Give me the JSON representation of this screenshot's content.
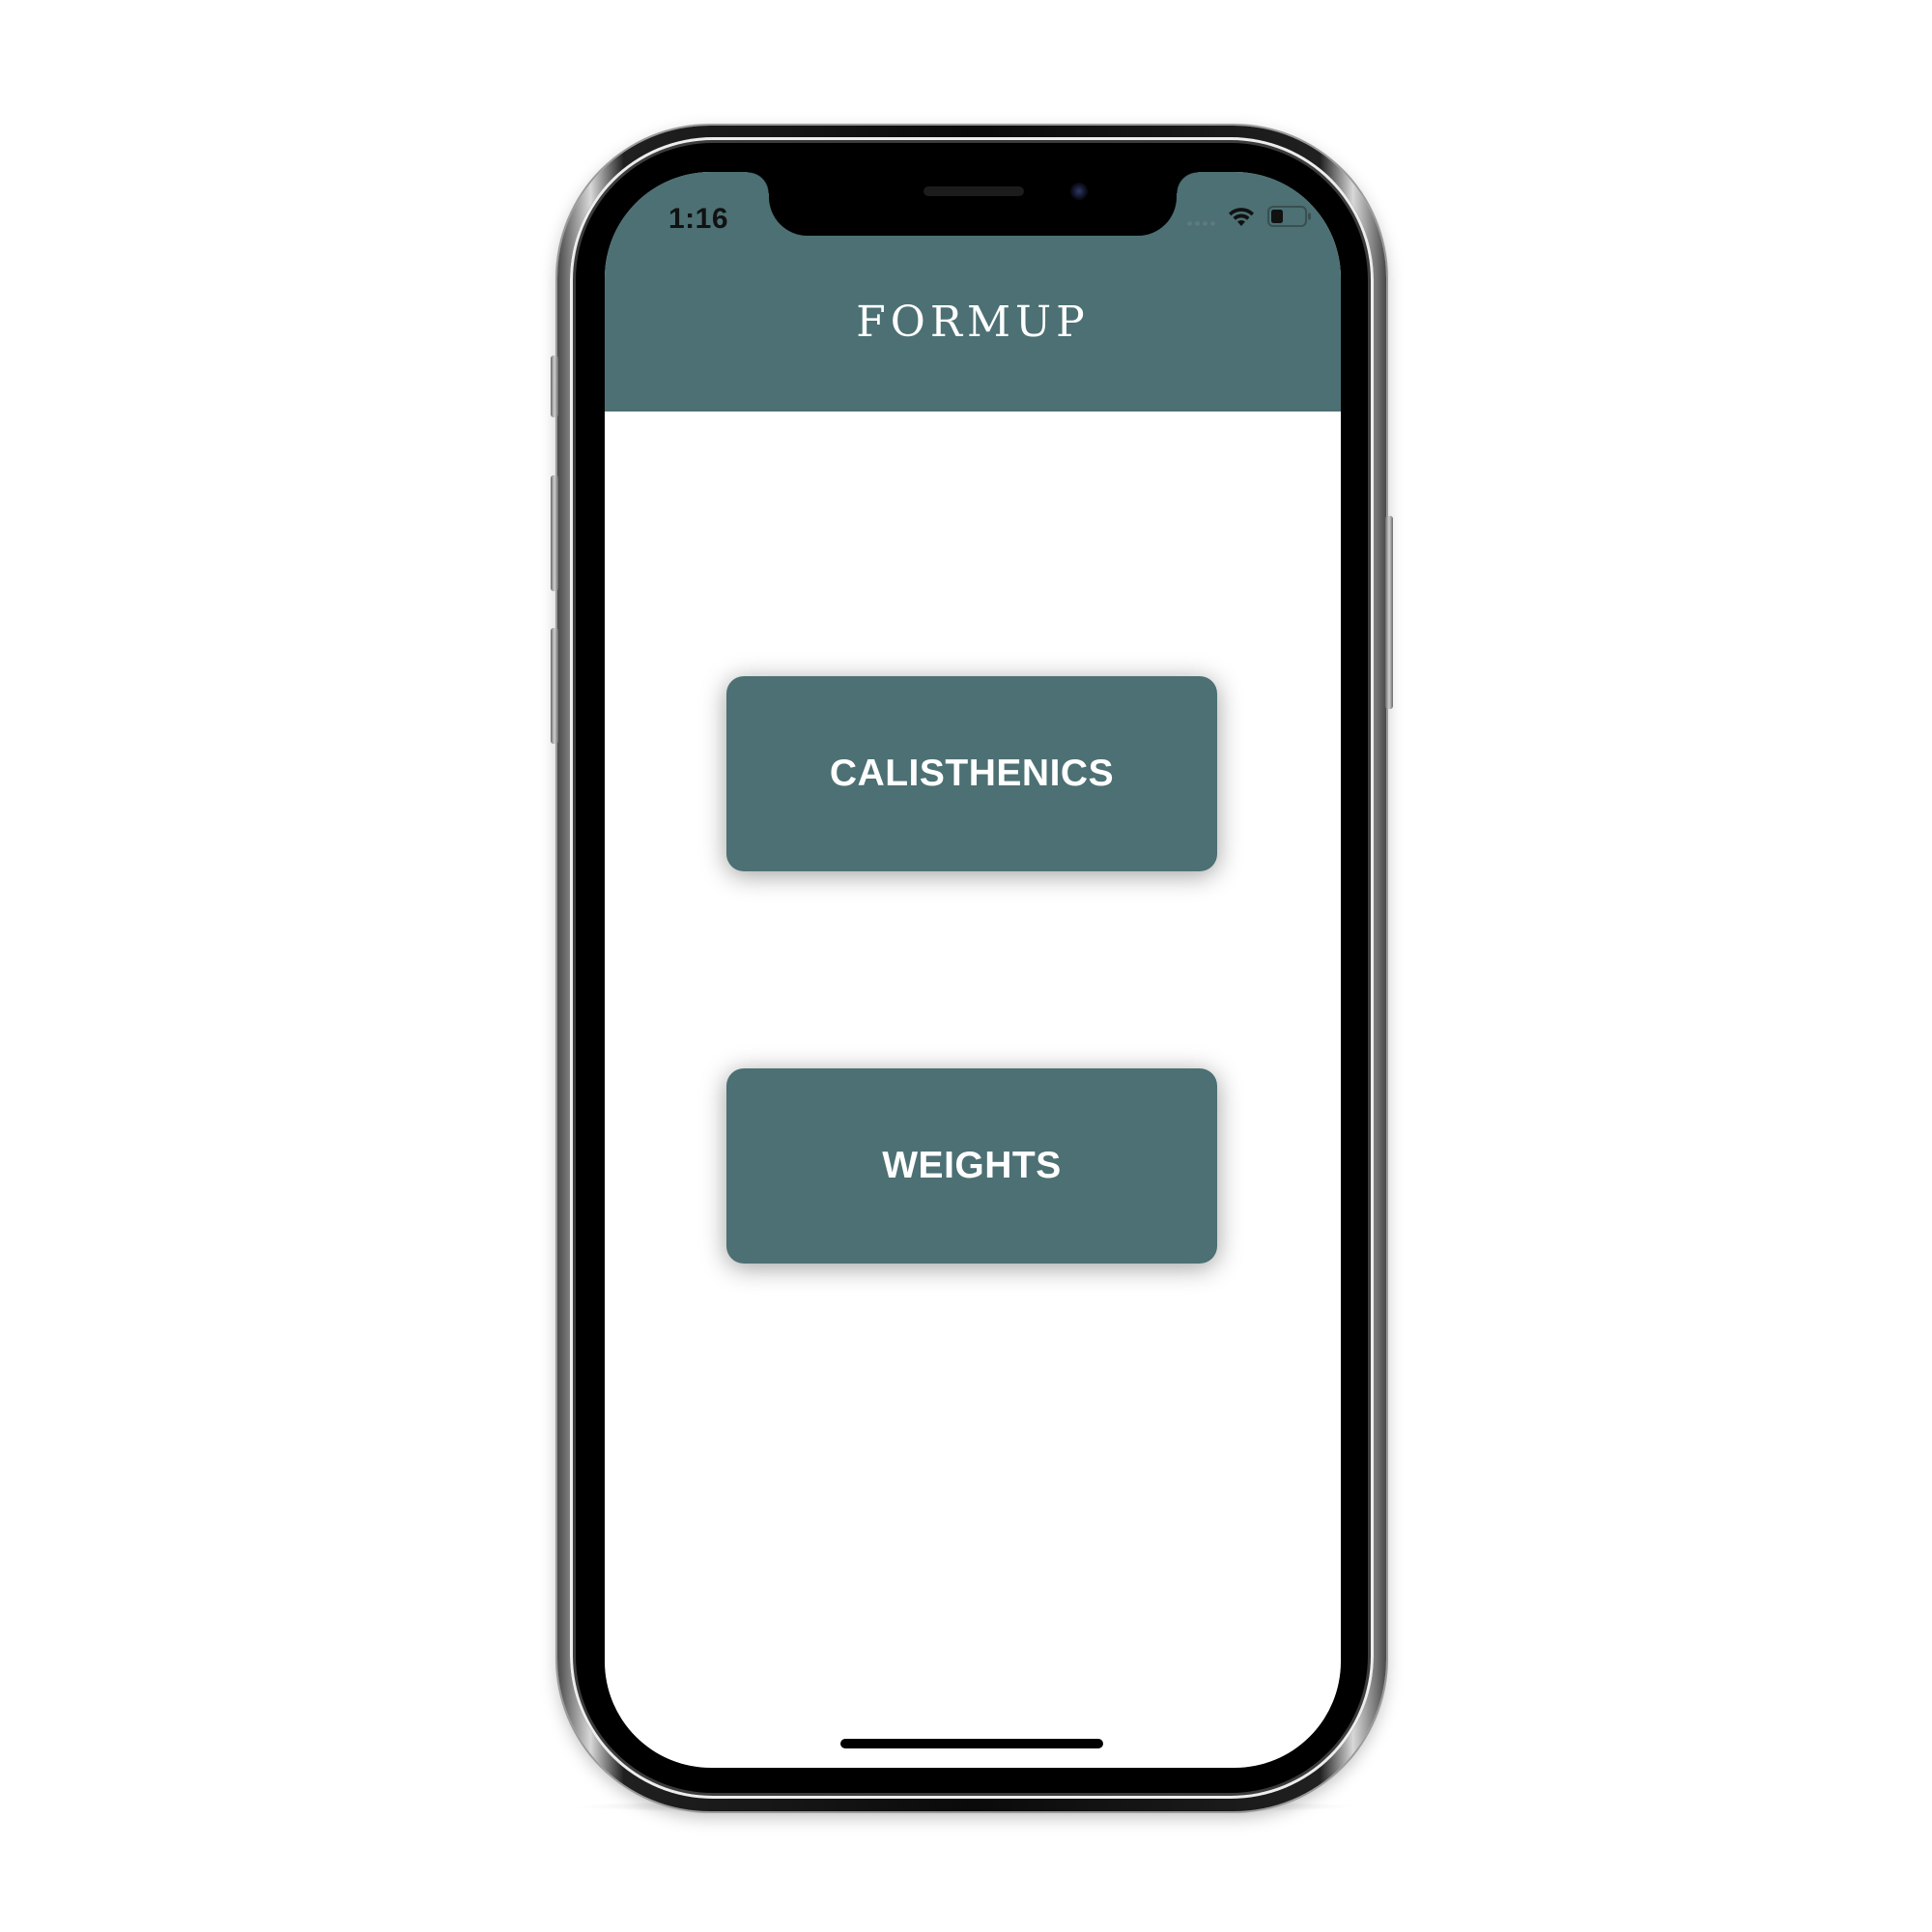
{
  "status_bar": {
    "time": "1:16",
    "icons": [
      "signal-dots-icon",
      "wifi-icon",
      "battery-icon"
    ]
  },
  "header": {
    "title": "FORMUP",
    "background_color": "#4c7073"
  },
  "menu": {
    "buttons": [
      {
        "label": "CALISTHENICS"
      },
      {
        "label": "WEIGHTS"
      }
    ],
    "button_color": "#4c7073",
    "text_color": "#ffffff"
  },
  "battery": {
    "level": 0.35
  }
}
